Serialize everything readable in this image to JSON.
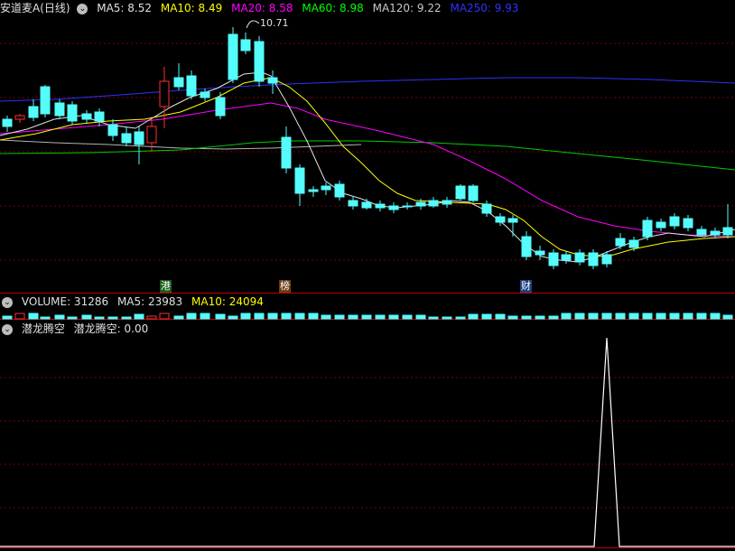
{
  "main_panel": {
    "title": "安道麦A(日线)",
    "ma": [
      {
        "label": "MA5: 8.52",
        "color": "#e0e0e0"
      },
      {
        "label": "MA10: 8.49",
        "color": "#ffff00"
      },
      {
        "label": "MA20: 8.58",
        "color": "#ff00ff"
      },
      {
        "label": "MA60: 8.98",
        "color": "#00ff00"
      },
      {
        "label": "MA120: 9.22",
        "color": "#c8c8c8"
      },
      {
        "label": "MA250: 9.93",
        "color": "#3030ff"
      }
    ],
    "high_label": "10.71",
    "tags": [
      {
        "text": "港",
        "bg": "#1a5d1a",
        "fg": "#ffffff"
      },
      {
        "text": "榜",
        "bg": "#6b3b10",
        "fg": "#ffffff"
      },
      {
        "text": "财",
        "bg": "#1d3f7a",
        "fg": "#ffffff"
      }
    ]
  },
  "volume_panel": {
    "label": "VOLUME: 31286",
    "ma5": "MA5: 23983",
    "ma10": "MA10: 24094"
  },
  "indicator_panel": {
    "name": "潜龙腾空",
    "value_label": "潜龙腾空: 0.00"
  },
  "colors": {
    "up": "#ff3030",
    "down": "#54fcfc",
    "grid": "#7a0000",
    "separator": "#c00000"
  }
}
